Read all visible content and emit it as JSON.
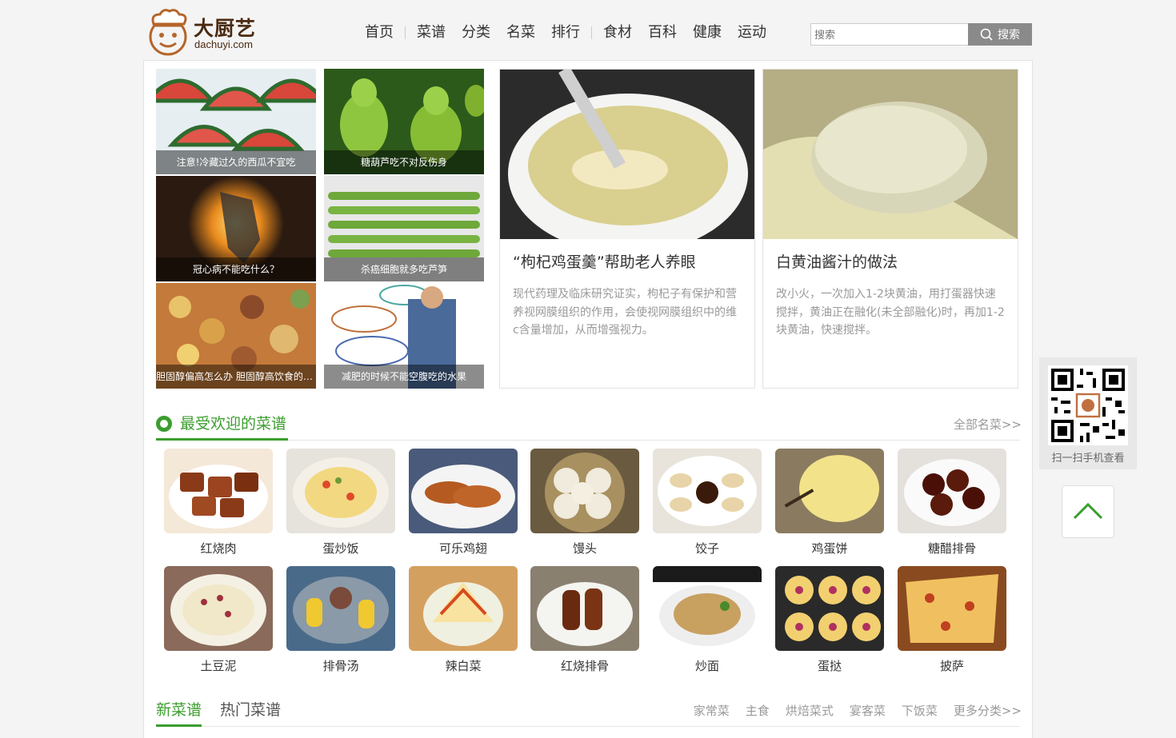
{
  "brand": {
    "name": "大厨艺",
    "domain": "dachuyi.com"
  },
  "nav": [
    "首页",
    "菜谱",
    "分类",
    "名菜",
    "排行",
    "食材",
    "百科",
    "健康",
    "运动"
  ],
  "search": {
    "placeholder": "搜索",
    "button": "搜索"
  },
  "thumbs": [
    "注意!冷藏过久的西瓜不宜吃",
    "糖葫芦吃不对反伤身",
    "冠心病不能吃什么？",
    "杀癌细胞就多吃芦笋",
    "胆固醇偏高怎么办 胆固醇高饮食的注意事项",
    "减肥的时候不能空腹吃的水果"
  ],
  "features": [
    {
      "title": "“枸杞鸡蛋羹”帮助老人养眼",
      "desc": "现代药理及临床研究证实，枸杞子有保护和营养视网膜组织的作用，会使视网膜组织中的维c含量增加，从而增强视力。"
    },
    {
      "title": "白黄油酱汁的做法",
      "desc": "改小火，一次加入1-2块黄油，用打蛋器快速搅拌，黄油正在融化(未全部融化)时，再加1-2块黄油，快速搅拌。"
    }
  ],
  "popular": {
    "title": "最受欢迎的菜谱",
    "more": "全部名菜>>"
  },
  "dishes": [
    "红烧肉",
    "蛋炒饭",
    "可乐鸡翅",
    "馒头",
    "饺子",
    "鸡蛋饼",
    "糖醋排骨",
    "土豆泥",
    "排骨汤",
    "辣白菜",
    "红烧排骨",
    "炒面",
    "蛋挞",
    "披萨"
  ],
  "tabs": {
    "active": "新菜谱",
    "inactive": "热门菜谱",
    "cats": [
      "家常菜",
      "主食",
      "烘焙菜式",
      "宴客菜",
      "下饭菜",
      "更多分类>>"
    ]
  },
  "qr": {
    "label": "扫一扫手机查看"
  },
  "colors": {
    "accent": "#3b9e2e",
    "search_button": "#8a8a8a"
  }
}
